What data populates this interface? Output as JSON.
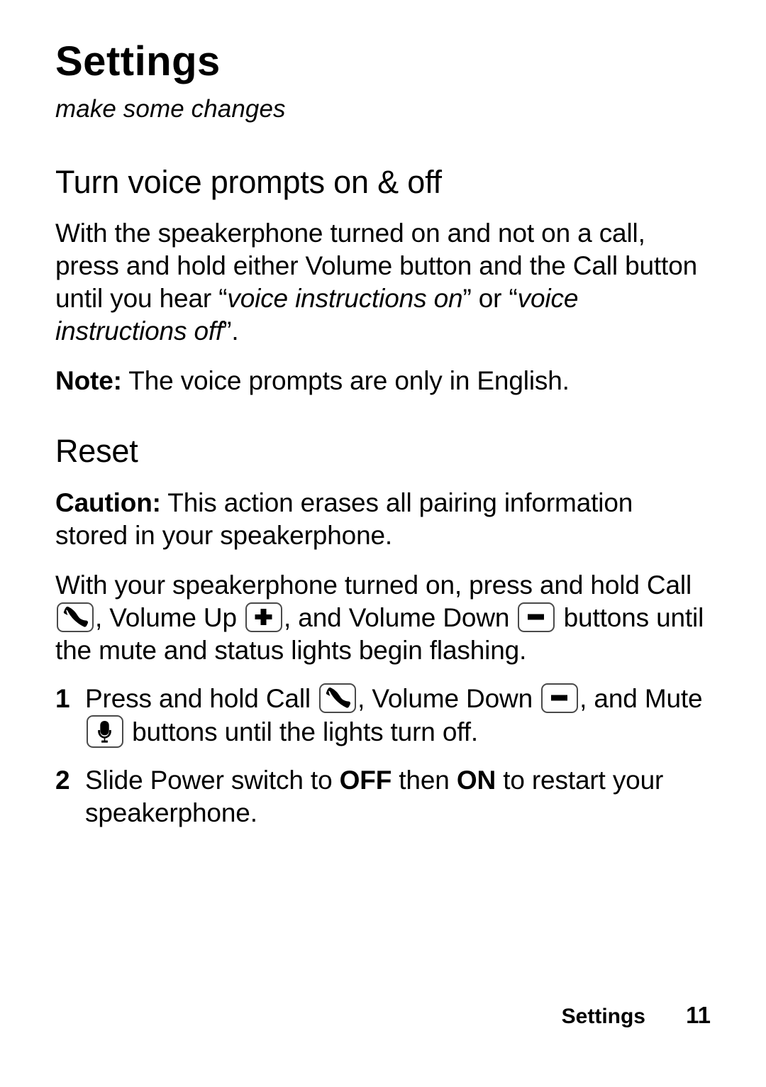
{
  "chapter": {
    "title": "Settings",
    "subtitle": "make some changes"
  },
  "sections": [
    {
      "heading": "Turn voice prompts on & off",
      "paragraph_1_part_1": "With the speakerphone turned on and not on a call, press and hold either Volume button and the Call button until you hear ",
      "paragraph_1_quote_1_open": "“",
      "paragraph_1_quote_1": "voice instructions on",
      "paragraph_1_quote_1_close": "”",
      "paragraph_1_part_2": " or ",
      "paragraph_1_quote_2_open": "“",
      "paragraph_1_quote_2": "voice instructions off",
      "paragraph_1_quote_2_close": "”",
      "paragraph_1_part_3": ".",
      "note_label": "Note:",
      "note_text": " The voice prompts are only in English."
    },
    {
      "heading": "Reset",
      "caution_label": "Caution:",
      "caution_text": " This action erases all pairing information stored in your speakerphone.",
      "intro_part_1": "With your speakerphone turned on, press and hold Call ",
      "intro_part_2": ", Volume Up ",
      "intro_part_3": ", and Volume Down ",
      "intro_part_4": " buttons until the mute and status lights begin flashing."
    }
  ],
  "steps": [
    {
      "number": "1",
      "part_1": "Press and hold Call ",
      "part_2": ", Volume Down ",
      "part_3": ", and Mute ",
      "part_4": " buttons until the lights turn off."
    },
    {
      "number": "2",
      "part_1": "Slide Power switch to ",
      "emphasis_1": "OFF",
      "part_2": " then ",
      "emphasis_2": "ON",
      "part_3": " to restart your speakerphone."
    }
  ],
  "icons": {
    "call": "call-handset-icon",
    "volume_up": "volume-up-plus-icon",
    "volume_down": "volume-down-minus-icon",
    "mute": "mute-microphone-icon"
  },
  "footer": {
    "chapter_label": "Settings",
    "page_number": "11"
  },
  "colors": {
    "text": "#000000",
    "keycap_border": "#4a4a4a",
    "background": "#ffffff"
  }
}
